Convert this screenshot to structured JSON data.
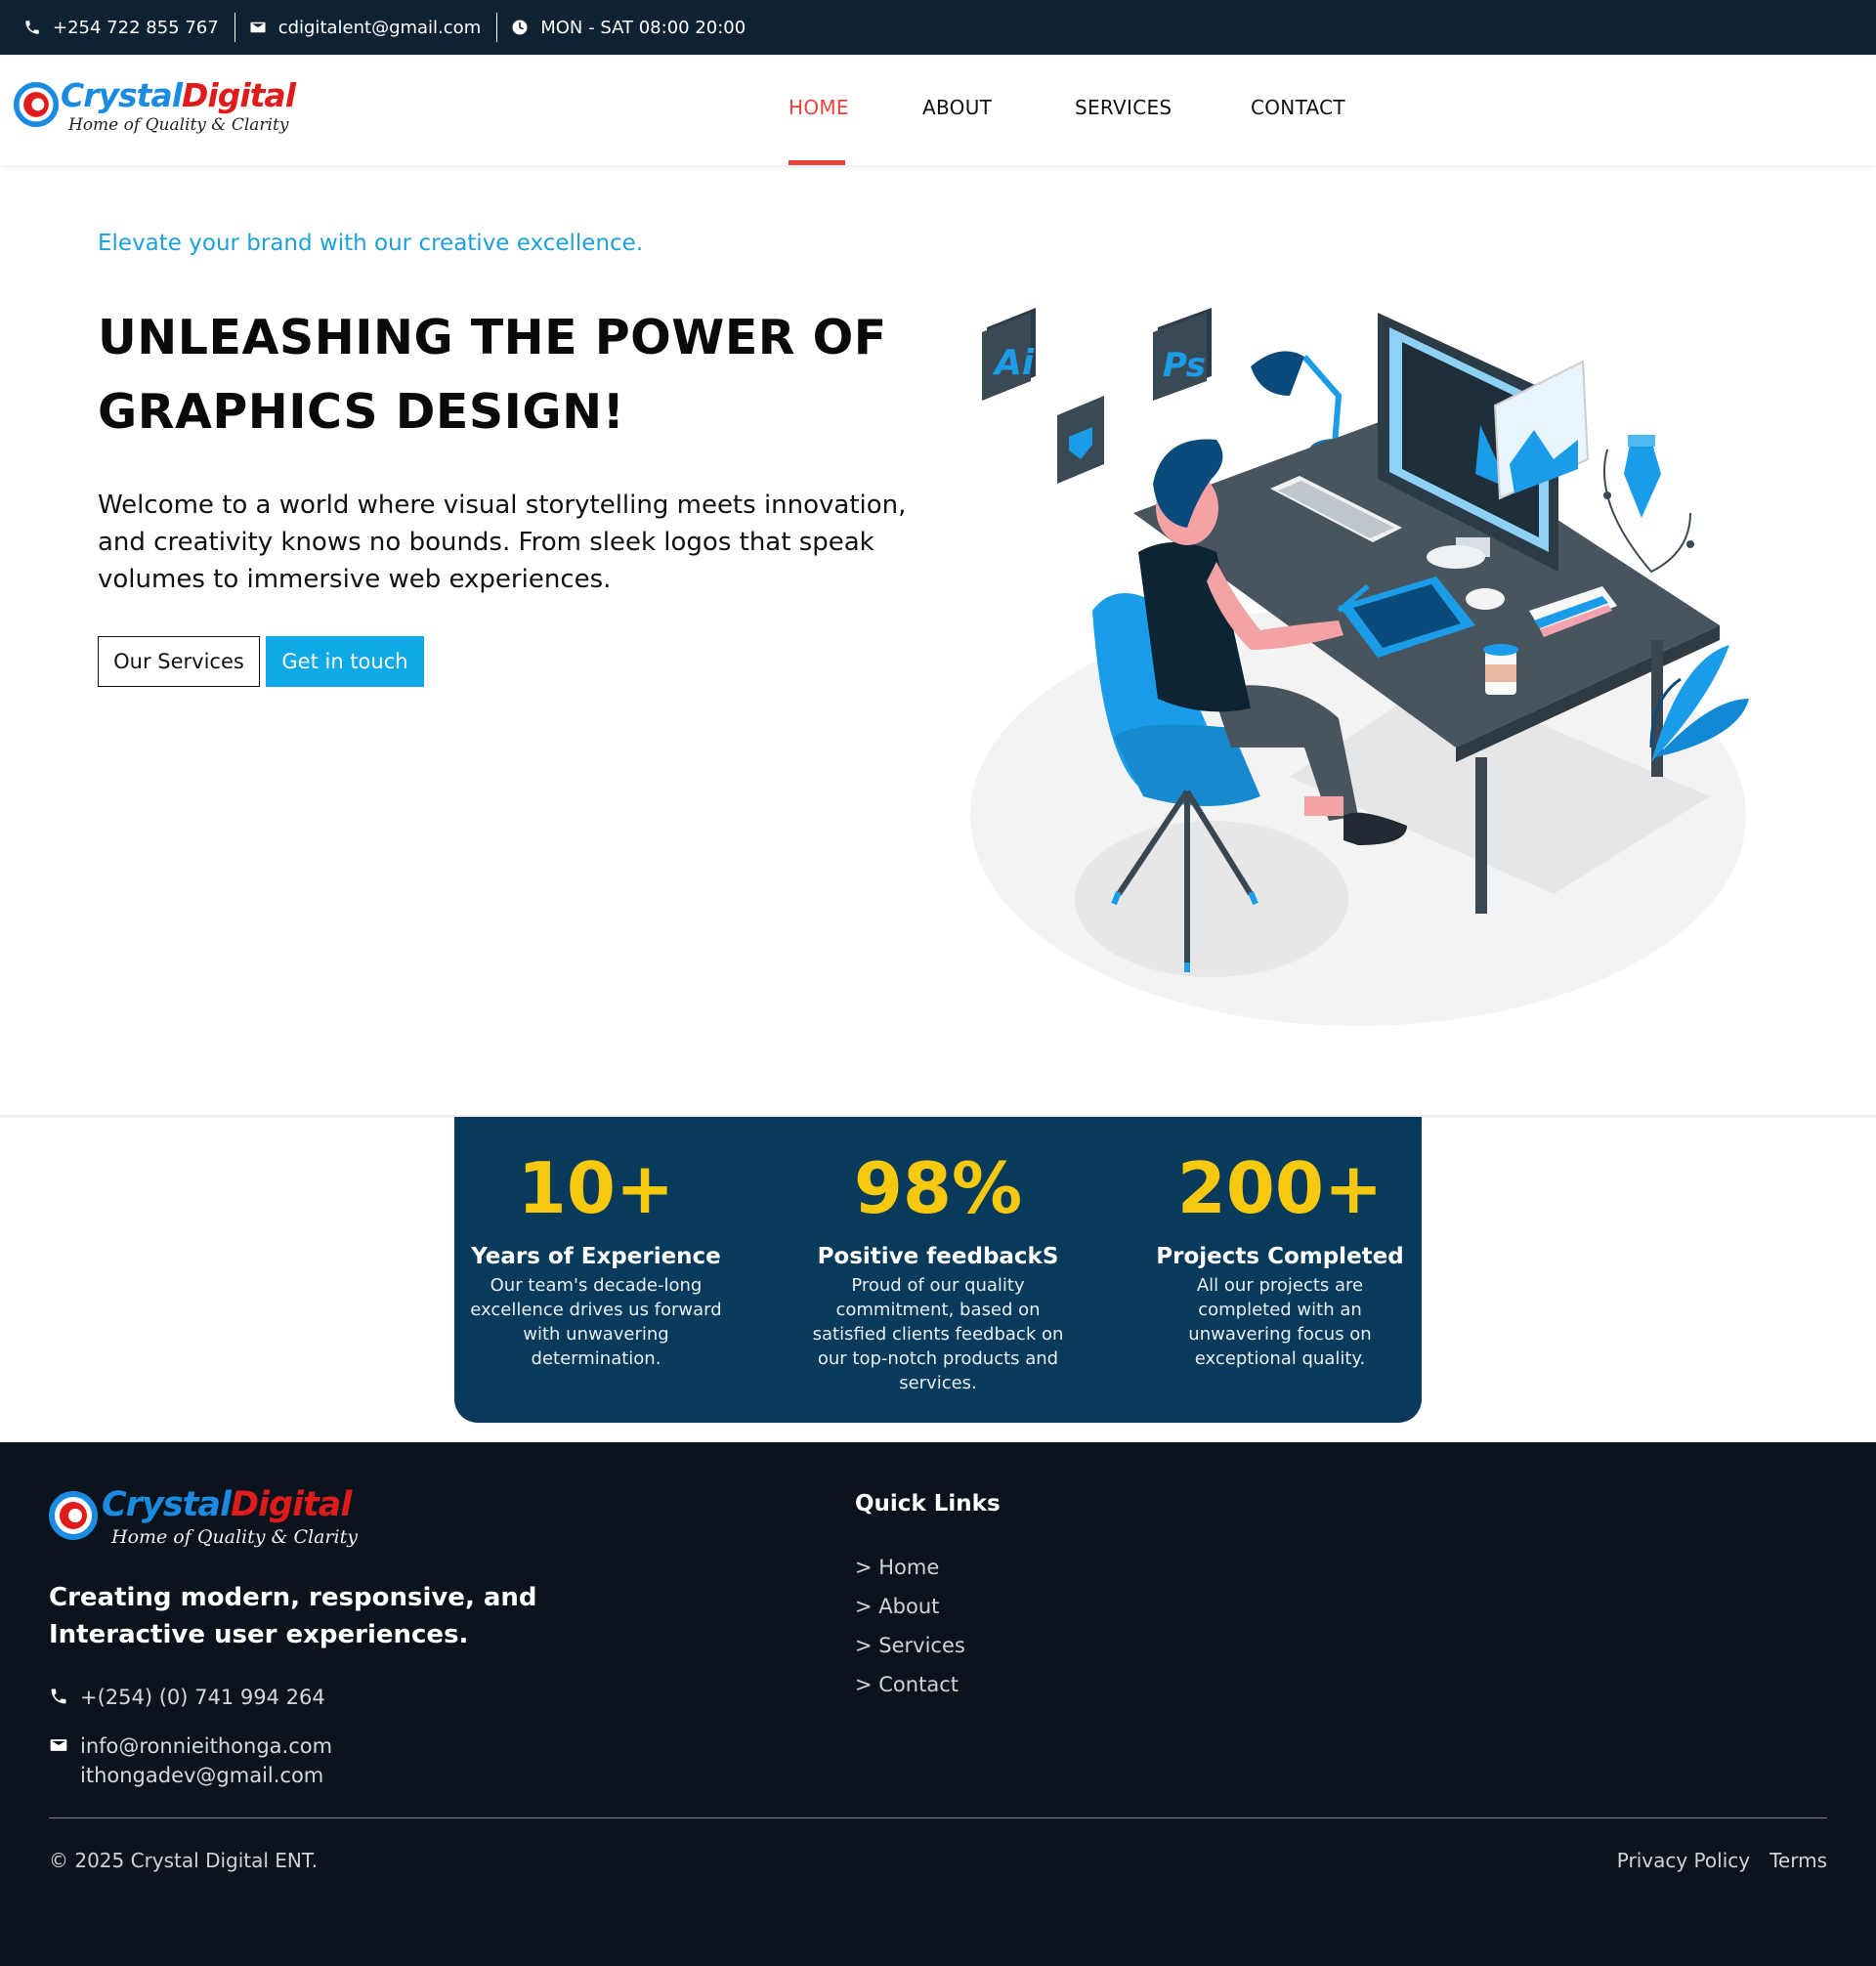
{
  "topbar": {
    "phone": "+254 722 855 767",
    "email": "cdigitalent@gmail.com",
    "hours": "MON - SAT 08:00 20:00"
  },
  "brand": {
    "name_part1": "Crystal",
    "name_part2": "Digital",
    "tagline": "Home of Quality & Clarity",
    "color_primary": "#1a8be0",
    "color_secondary": "#e01b1b"
  },
  "nav": {
    "items": [
      {
        "label": "HOME",
        "active": true
      },
      {
        "label": "ABOUT",
        "active": false
      },
      {
        "label": "SERVICES",
        "active": false
      },
      {
        "label": "CONTACT",
        "active": false
      }
    ],
    "active_color": "#e8423f"
  },
  "hero": {
    "subtitle": "Elevate your brand with our creative excellence.",
    "title_line1": "UNLEASHING THE POWER OF",
    "title_line2": "GRAPHICS DESIGN!",
    "text": "Welcome to a world where visual storytelling meets innovation, and creativity knows no bounds. From sleek logos that speak volumes to immersive web experiences.",
    "btn_services": "Our Services",
    "btn_contact": "Get in touch",
    "illustration": {
      "icons": [
        "ai-app-icon",
        "ps-app-icon",
        "sketch-app-icon"
      ],
      "accent": "#1b9ce8"
    }
  },
  "stats": [
    {
      "value": "10+",
      "label": "Years of Experience",
      "desc": "Our team's decade-long excellence drives us forward with unwavering determination."
    },
    {
      "value": "98%",
      "label": "Positive feedbackS",
      "desc": "Proud of our quality commitment, based on satisfied clients feedback on our top-notch products and services."
    },
    {
      "value": "200+",
      "label": "Projects Completed",
      "desc": "All our projects are completed with an unwavering focus on exceptional quality."
    }
  ],
  "footer": {
    "tagline": "Creating modern, responsive, and Interactive user experiences.",
    "phone": "+(254) (0) 741 994 264",
    "email1": "info@ronnieithonga.com",
    "email2": "ithongadev@gmail.com",
    "quick_links_title": "Quick Links",
    "quick_links": [
      "> Home",
      "> About",
      "> Services",
      "> Contact"
    ],
    "copyright": "© 2025 Crystal Digital ENT.",
    "privacy": "Privacy Policy",
    "terms": "Terms"
  }
}
